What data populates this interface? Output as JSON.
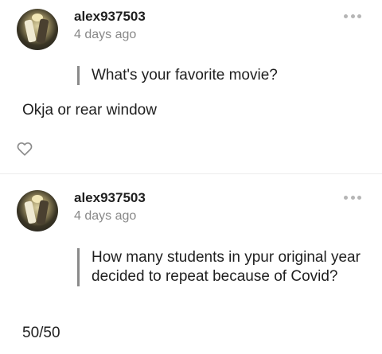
{
  "posts": [
    {
      "username": "alex937503",
      "timestamp": "4 days ago",
      "question": "What's your favorite movie?",
      "answer": "Okja or rear window"
    },
    {
      "username": "alex937503",
      "timestamp": "4 days ago",
      "question": "How many students in ypur original year decided to repeat because of Covid?",
      "answer": "50/50"
    }
  ],
  "icons": {
    "more": "more-dots-icon",
    "like": "heart-icon"
  },
  "colors": {
    "text": "#1f1f1f",
    "muted": "#888888",
    "quote_bar": "#8a8a8a",
    "dots": "#b5b5b5"
  }
}
